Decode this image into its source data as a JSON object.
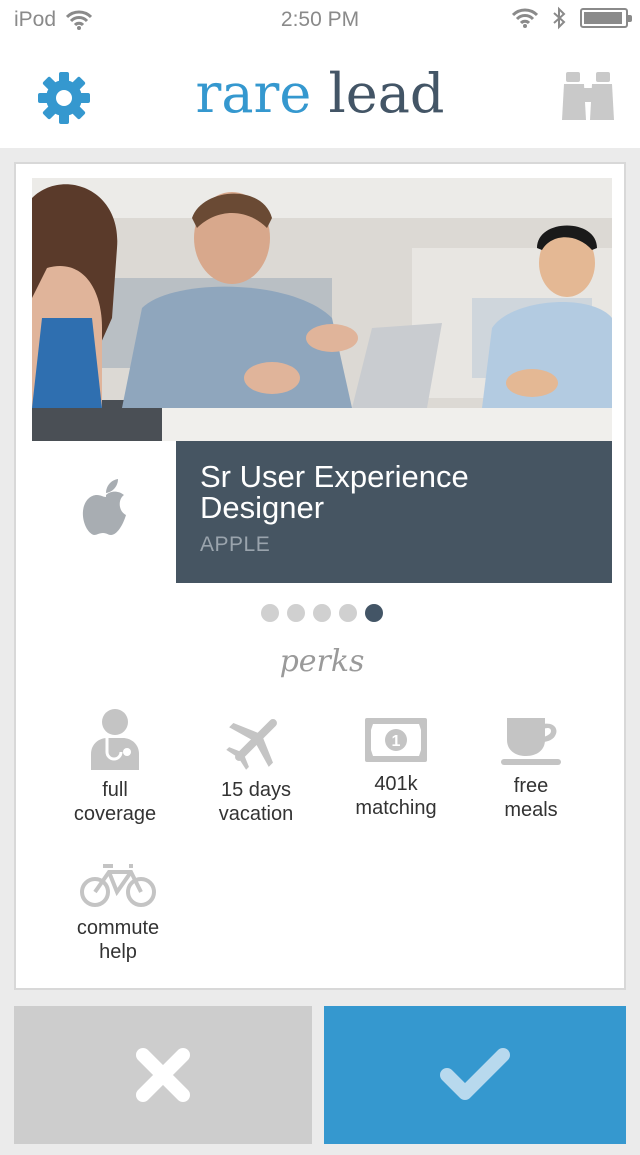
{
  "status_bar": {
    "carrier": "iPod",
    "time": "2:50 PM"
  },
  "nav": {
    "brand_first": "rare",
    "brand_second": "lead",
    "left_icon": "gear-icon",
    "right_icon": "binoculars-icon"
  },
  "job": {
    "title": "Sr User Experience Designer",
    "company": "APPLE",
    "logo_icon": "apple-logo-icon"
  },
  "pagination": {
    "count": 5,
    "active_index": 4
  },
  "perks": {
    "heading": "perks",
    "items": [
      {
        "icon": "doctor-icon",
        "line1": "full",
        "line2": "coverage"
      },
      {
        "icon": "airplane-icon",
        "line1": "15 days",
        "line2": "vacation"
      },
      {
        "icon": "money-icon",
        "line1": "401k",
        "line2": "matching"
      },
      {
        "icon": "coffee-cup-icon",
        "line1": "free",
        "line2": "meals"
      },
      {
        "icon": "bicycle-icon",
        "line1": "commute",
        "line2": "help"
      }
    ]
  },
  "actions": {
    "reject_icon": "close-icon",
    "accept_icon": "checkmark-icon"
  },
  "colors": {
    "brand_blue": "#3598cf",
    "brand_slate": "#435566",
    "job_box_bg": "#465562",
    "reject_bg": "#cdcdcd"
  }
}
